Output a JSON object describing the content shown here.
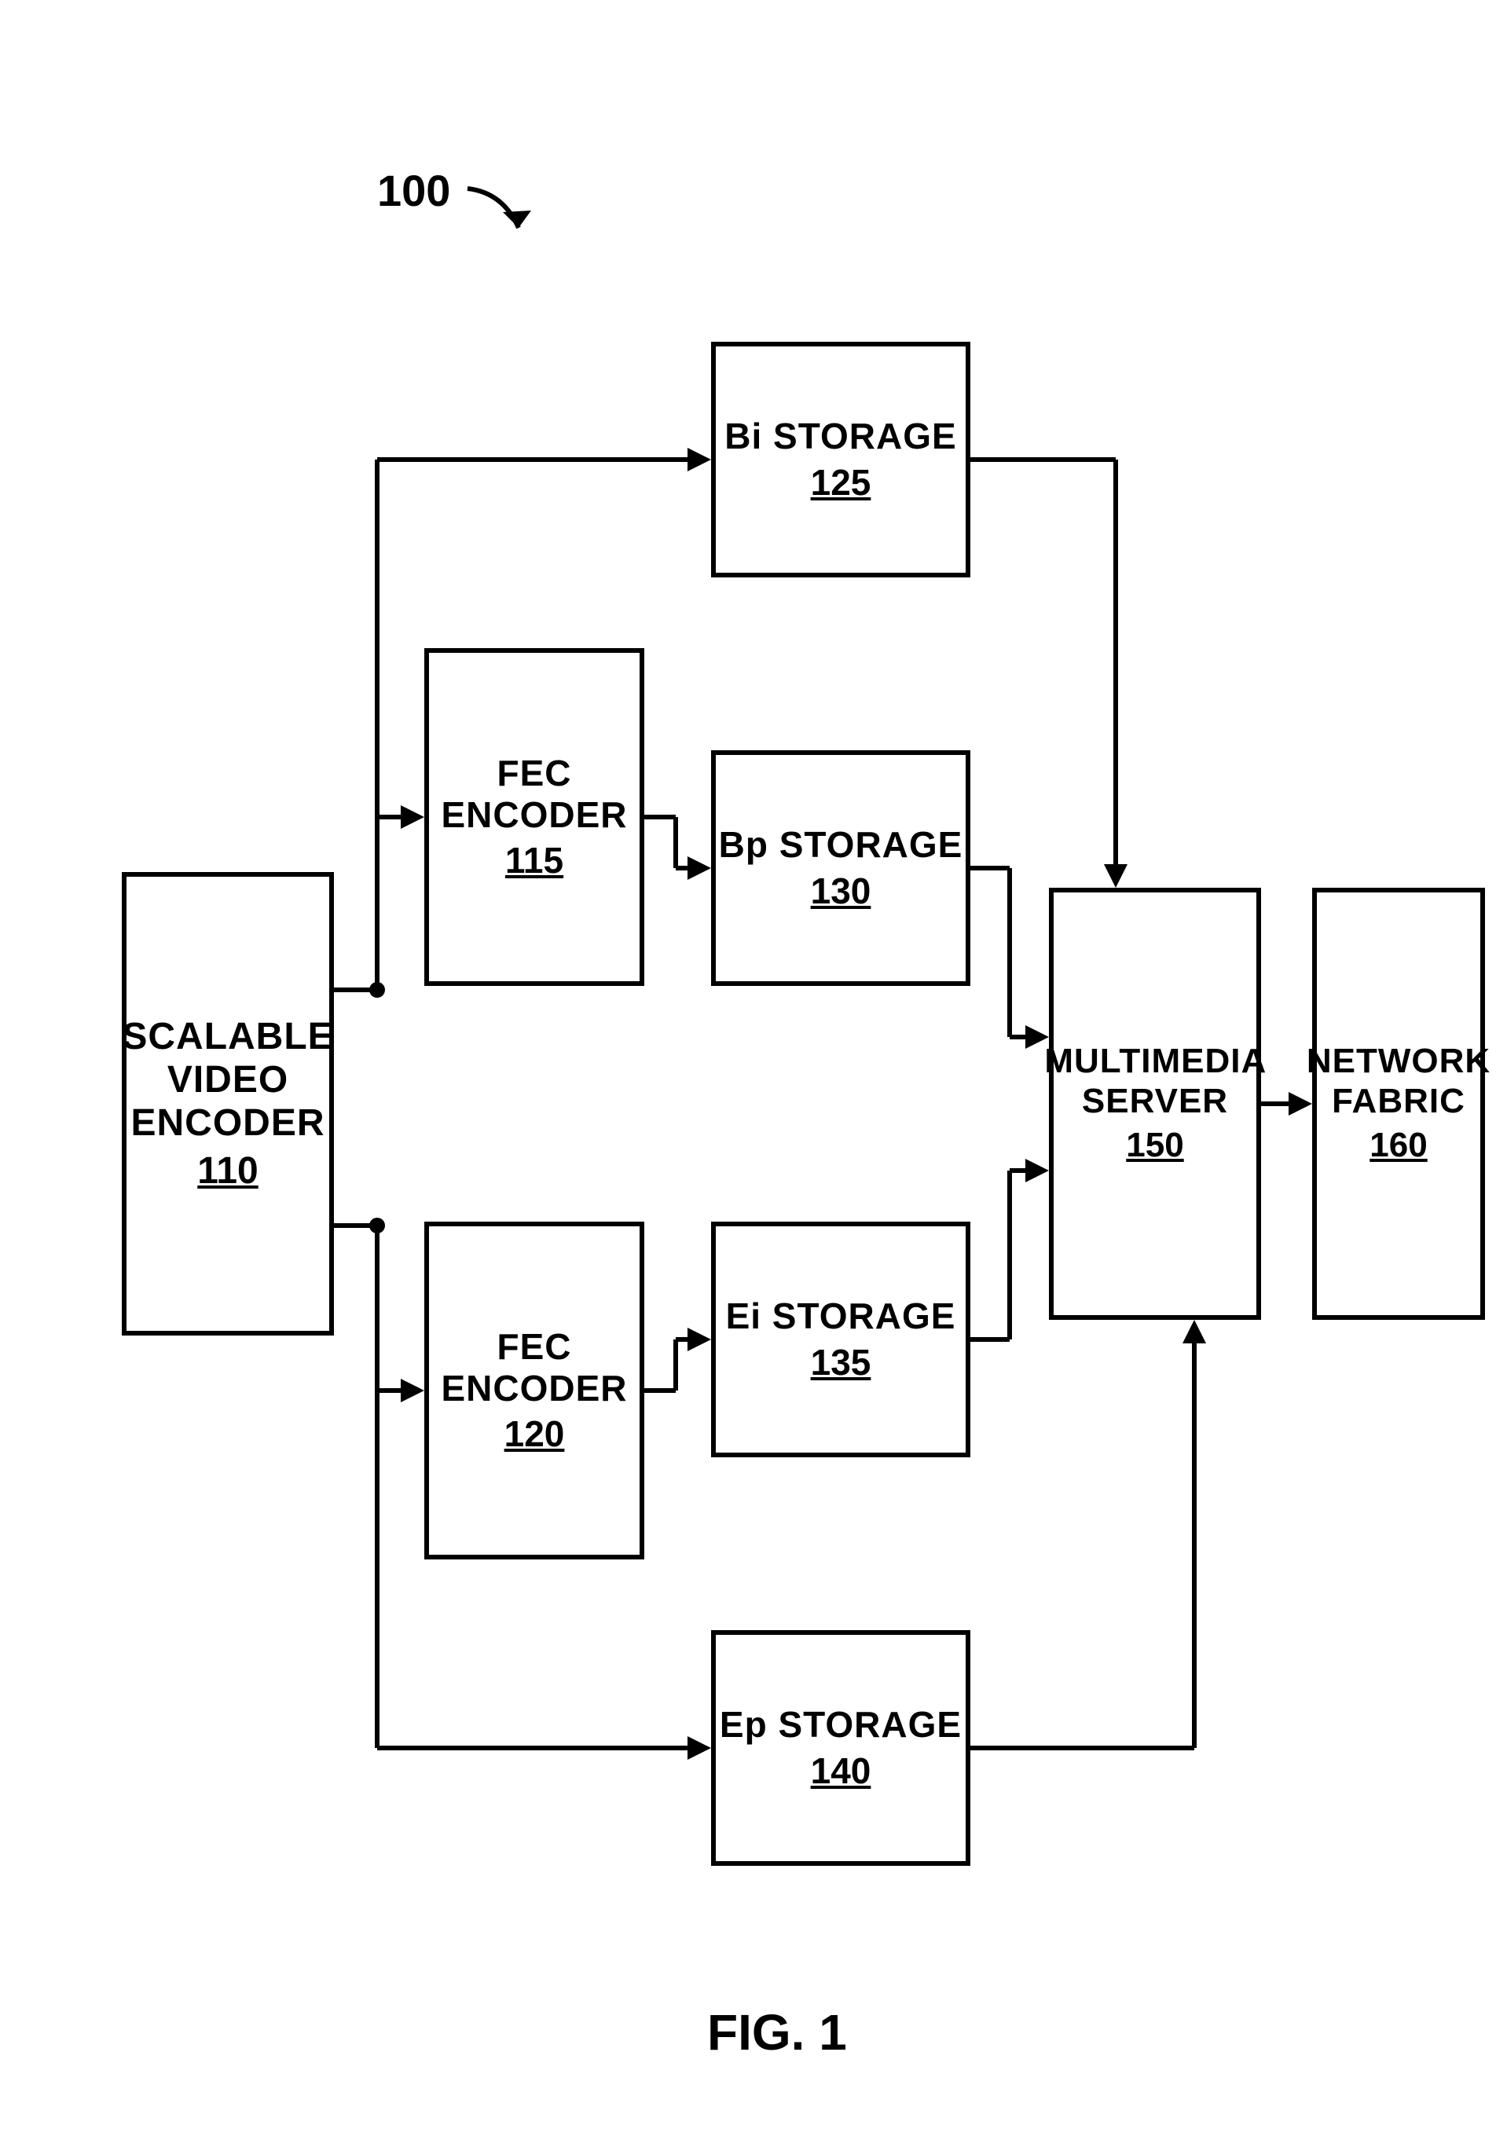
{
  "diagram_id_label": "100",
  "figure_label": "FIG. 1",
  "blocks": {
    "scalable_video_encoder": {
      "title": "SCALABLE VIDEO ENCODER",
      "num": "110"
    },
    "fec_encoder_top": {
      "title": "FEC ENCODER",
      "num": "115"
    },
    "fec_encoder_bottom": {
      "title": "FEC ENCODER",
      "num": "120"
    },
    "bi_storage": {
      "title": "Bi STORAGE",
      "num": "125"
    },
    "bp_storage": {
      "title": "Bp STORAGE",
      "num": "130"
    },
    "ei_storage": {
      "title": "Ei STORAGE",
      "num": "135"
    },
    "ep_storage": {
      "title": "Ep STORAGE",
      "num": "140"
    },
    "multimedia_server": {
      "title": "MULTIMEDIA SERVER",
      "num": "150"
    },
    "network_fabric": {
      "title": "NETWORK FABRIC",
      "num": "160"
    }
  }
}
